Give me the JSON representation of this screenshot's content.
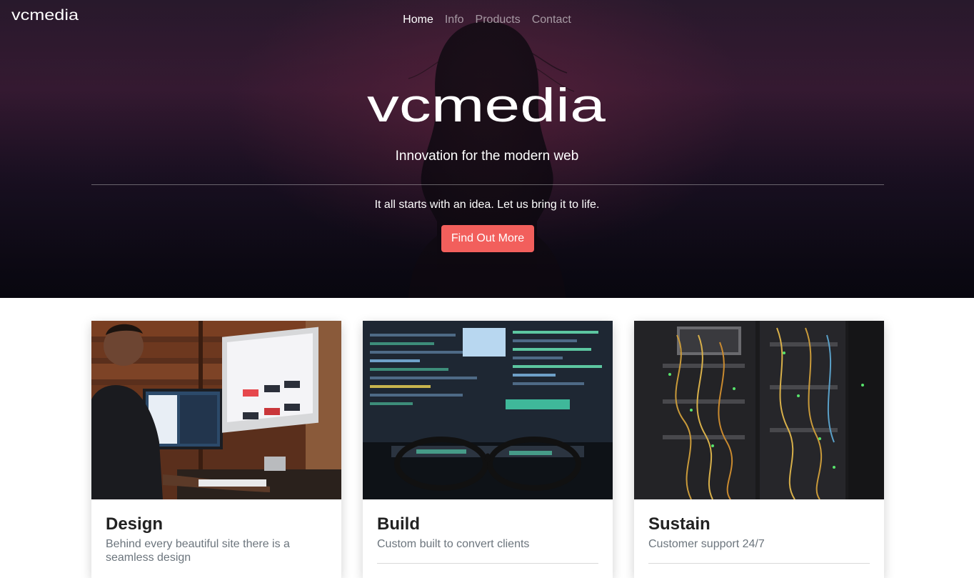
{
  "brand": {
    "name": "vcmedia"
  },
  "nav": {
    "items": [
      {
        "label": "Home",
        "active": true
      },
      {
        "label": "Info",
        "active": false
      },
      {
        "label": "Products",
        "active": false
      },
      {
        "label": "Contact",
        "active": false
      }
    ]
  },
  "hero": {
    "logo_text": "vcmedia",
    "tagline": "Innovation for the modern web",
    "lead": "It all starts with an idea. Let us bring it to life.",
    "cta_label": "Find Out More"
  },
  "cards": [
    {
      "title": "Design",
      "description": "Behind every beautiful site there is a seamless design",
      "image": "designer-at-computer-photo"
    },
    {
      "title": "Build",
      "description": "Custom built to convert clients",
      "image": "code-screen-with-glasses-photo"
    },
    {
      "title": "Sustain",
      "description": "Customer support 24/7",
      "image": "server-rack-cables-photo"
    }
  ],
  "colors": {
    "accent": "#f25f5c",
    "hero_dark": "#0c0b17",
    "text_muted": "#6c757d"
  }
}
